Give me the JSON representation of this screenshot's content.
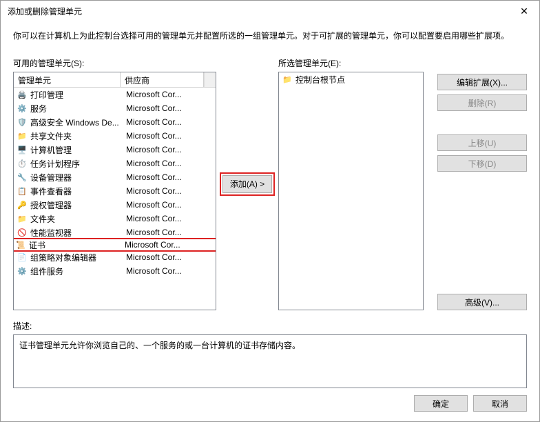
{
  "titlebar": {
    "title": "添加或删除管理单元"
  },
  "intro": "你可以在计算机上为此控制台选择可用的管理单元并配置所选的一组管理单元。对于可扩展的管理单元，你可以配置要启用哪些扩展项。",
  "available": {
    "label": "可用的管理单元(S):",
    "header_name": "管理单元",
    "header_vendor": "供应商",
    "items": [
      {
        "name": "打印管理",
        "vendor": "Microsoft Cor...",
        "icon": "🖨️",
        "selected": false
      },
      {
        "name": "服务",
        "vendor": "Microsoft Cor...",
        "icon": "⚙️",
        "selected": false
      },
      {
        "name": "高级安全 Windows De...",
        "vendor": "Microsoft Cor...",
        "icon": "🛡️",
        "selected": false
      },
      {
        "name": "共享文件夹",
        "vendor": "Microsoft Cor...",
        "icon": "📁",
        "selected": false
      },
      {
        "name": "计算机管理",
        "vendor": "Microsoft Cor...",
        "icon": "🖥️",
        "selected": false
      },
      {
        "name": "任务计划程序",
        "vendor": "Microsoft Cor...",
        "icon": "⏱️",
        "selected": false
      },
      {
        "name": "设备管理器",
        "vendor": "Microsoft Cor...",
        "icon": "🔧",
        "selected": false
      },
      {
        "name": "事件查看器",
        "vendor": "Microsoft Cor...",
        "icon": "📋",
        "selected": false
      },
      {
        "name": "授权管理器",
        "vendor": "Microsoft Cor...",
        "icon": "🔑",
        "selected": false
      },
      {
        "name": "文件夹",
        "vendor": "Microsoft Cor...",
        "icon": "📁",
        "selected": false
      },
      {
        "name": "性能监视器",
        "vendor": "Microsoft Cor...",
        "icon": "🚫",
        "selected": false
      },
      {
        "name": "证书",
        "vendor": "Microsoft Cor...",
        "icon": "📜",
        "selected": true
      },
      {
        "name": "组策略对象编辑器",
        "vendor": "Microsoft Cor...",
        "icon": "📄",
        "selected": false
      },
      {
        "name": "组件服务",
        "vendor": "Microsoft Cor...",
        "icon": "⚙️",
        "selected": false
      }
    ]
  },
  "addButton": {
    "label": "添加(A) >"
  },
  "selected": {
    "label": "所选管理单元(E):",
    "items": [
      {
        "name": "控制台根节点",
        "icon": "📁"
      }
    ]
  },
  "sideButtons": {
    "editExtensions": "编辑扩展(X)...",
    "remove": "删除(R)",
    "moveUp": "上移(U)",
    "moveDown": "下移(D)",
    "advanced": "高级(V)..."
  },
  "description": {
    "label": "描述:",
    "text": "证书管理单元允许你浏览自己的、一个服务的或一台计算机的证书存储内容。"
  },
  "footer": {
    "ok": "确定",
    "cancel": "取消"
  }
}
